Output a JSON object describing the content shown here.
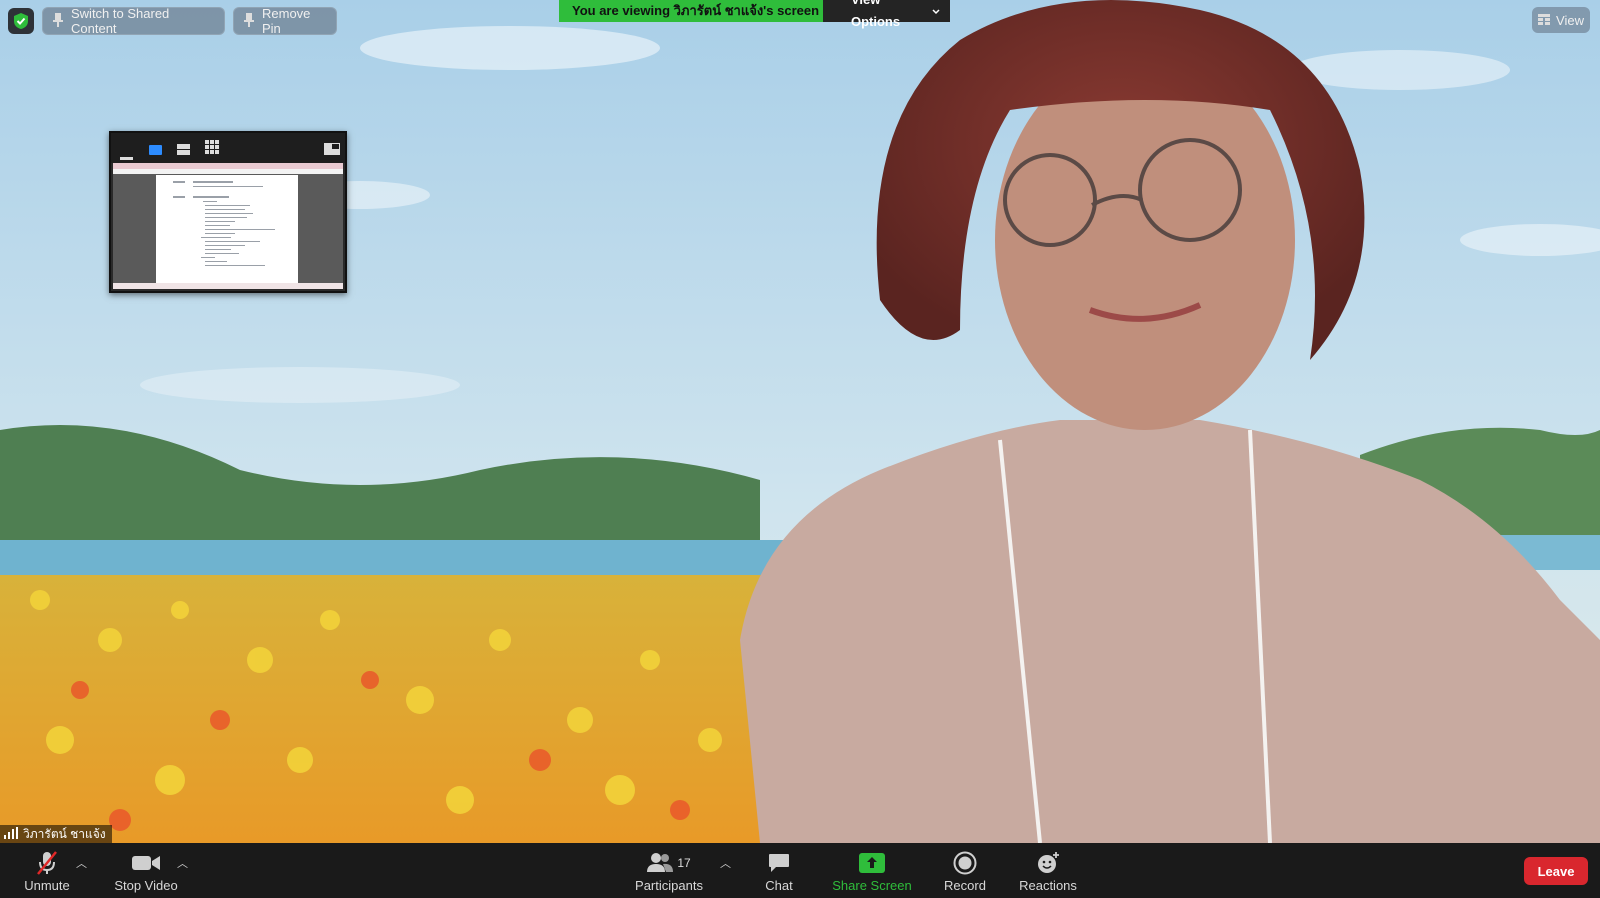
{
  "top_controls": {
    "switch_label": "Switch to Shared Content",
    "remove_pin_label": "Remove Pin",
    "view_label": "View"
  },
  "banner": {
    "viewing_text": "You are viewing วิภารัตน์ ชาแจ้ง's screen",
    "view_options_label": "View Options"
  },
  "participant": {
    "name": "วิภารัตน์ ชาแจ้ง"
  },
  "toolbar": {
    "unmute_label": "Unmute",
    "stop_video_label": "Stop Video",
    "participants_label": "Participants",
    "participants_count": "17",
    "chat_label": "Chat",
    "share_screen_label": "Share Screen",
    "record_label": "Record",
    "reactions_label": "Reactions",
    "leave_label": "Leave"
  },
  "colors": {
    "banner_green": "#2fbd3b",
    "share_green": "#2fbd3b",
    "leave_red": "#d9272e",
    "toolbar_bg": "#1a1a1a"
  }
}
